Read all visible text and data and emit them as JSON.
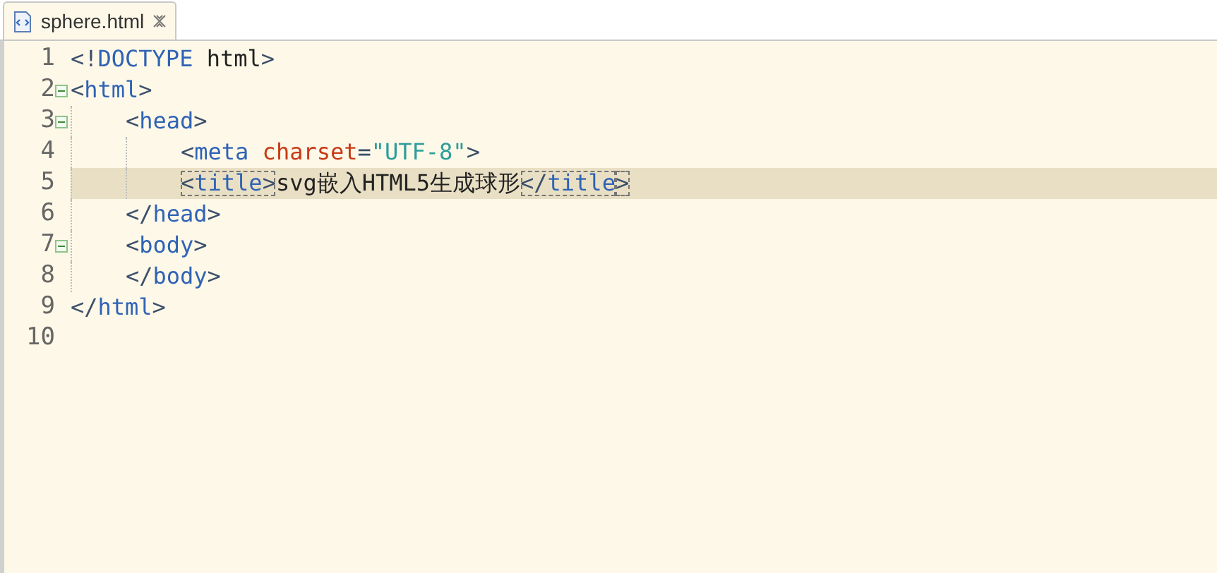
{
  "tab": {
    "label": "sphere.html",
    "selected": true
  },
  "lines": [
    {
      "number": "1",
      "foldable": false,
      "highlighted": false,
      "segments": [
        {
          "boxed": false,
          "tokens": [
            {
              "kind": "punct",
              "text": "<!"
            },
            {
              "kind": "tag",
              "text": "DOCTYPE"
            },
            {
              "kind": "text",
              "text": " html"
            },
            {
              "kind": "punct",
              "text": ">"
            }
          ]
        }
      ]
    },
    {
      "number": "2",
      "foldable": true,
      "highlighted": false,
      "segments": [
        {
          "boxed": false,
          "tokens": [
            {
              "kind": "punct",
              "text": "<"
            },
            {
              "kind": "tag",
              "text": "html"
            },
            {
              "kind": "punct",
              "text": ">"
            }
          ]
        }
      ],
      "children": [
        {
          "number": "3",
          "foldable": true,
          "highlighted": false,
          "segments": [
            {
              "boxed": false,
              "tokens": [
                {
                  "kind": "punct",
                  "text": "<"
                },
                {
                  "kind": "tag",
                  "text": "head"
                },
                {
                  "kind": "punct",
                  "text": ">"
                }
              ]
            }
          ],
          "children": [
            {
              "number": "4",
              "foldable": false,
              "highlighted": false,
              "segments": [
                {
                  "boxed": false,
                  "tokens": [
                    {
                      "kind": "punct",
                      "text": "<"
                    },
                    {
                      "kind": "tag",
                      "text": "meta"
                    },
                    {
                      "kind": "attr",
                      "text": " charset"
                    },
                    {
                      "kind": "punct",
                      "text": "="
                    },
                    {
                      "kind": "value",
                      "text": "\"UTF-8\""
                    },
                    {
                      "kind": "punct",
                      "text": ">"
                    }
                  ]
                }
              ]
            },
            {
              "number": "5",
              "foldable": false,
              "highlighted": true,
              "segments": [
                {
                  "boxed": true,
                  "tokens": [
                    {
                      "kind": "punct",
                      "text": "<"
                    },
                    {
                      "kind": "tag",
                      "text": "title"
                    },
                    {
                      "kind": "punct",
                      "text": ">"
                    }
                  ]
                },
                {
                  "boxed": false,
                  "tokens": [
                    {
                      "kind": "text",
                      "text": "svg嵌入HTML5生成球形"
                    }
                  ]
                },
                {
                  "boxed": true,
                  "tokens": [
                    {
                      "kind": "punct",
                      "text": "</"
                    },
                    {
                      "kind": "tag",
                      "text": "title"
                    }
                  ]
                },
                {
                  "boxed": true,
                  "tokens": [
                    {
                      "kind": "punct",
                      "text": ">"
                    }
                  ]
                }
              ]
            }
          ]
        },
        {
          "number": "6",
          "foldable": false,
          "highlighted": false,
          "segments": [
            {
              "boxed": false,
              "tokens": [
                {
                  "kind": "punct",
                  "text": "</"
                },
                {
                  "kind": "tag",
                  "text": "head"
                },
                {
                  "kind": "punct",
                  "text": ">"
                }
              ]
            }
          ]
        },
        {
          "number": "7",
          "foldable": true,
          "highlighted": false,
          "segments": [
            {
              "boxed": false,
              "tokens": [
                {
                  "kind": "punct",
                  "text": "<"
                },
                {
                  "kind": "tag",
                  "text": "body"
                },
                {
                  "kind": "punct",
                  "text": ">"
                }
              ]
            }
          ]
        },
        {
          "number": "8",
          "foldable": false,
          "highlighted": false,
          "segments": [
            {
              "boxed": false,
              "tokens": [
                {
                  "kind": "punct",
                  "text": "</"
                },
                {
                  "kind": "tag",
                  "text": "body"
                },
                {
                  "kind": "punct",
                  "text": ">"
                }
              ]
            }
          ]
        }
      ]
    },
    {
      "number": "9",
      "foldable": false,
      "highlighted": false,
      "segments": [
        {
          "boxed": false,
          "tokens": [
            {
              "kind": "punct",
              "text": "</"
            },
            {
              "kind": "tag",
              "text": "html"
            },
            {
              "kind": "punct",
              "text": ">"
            }
          ]
        }
      ]
    },
    {
      "number": "10",
      "foldable": false,
      "highlighted": false
    }
  ]
}
